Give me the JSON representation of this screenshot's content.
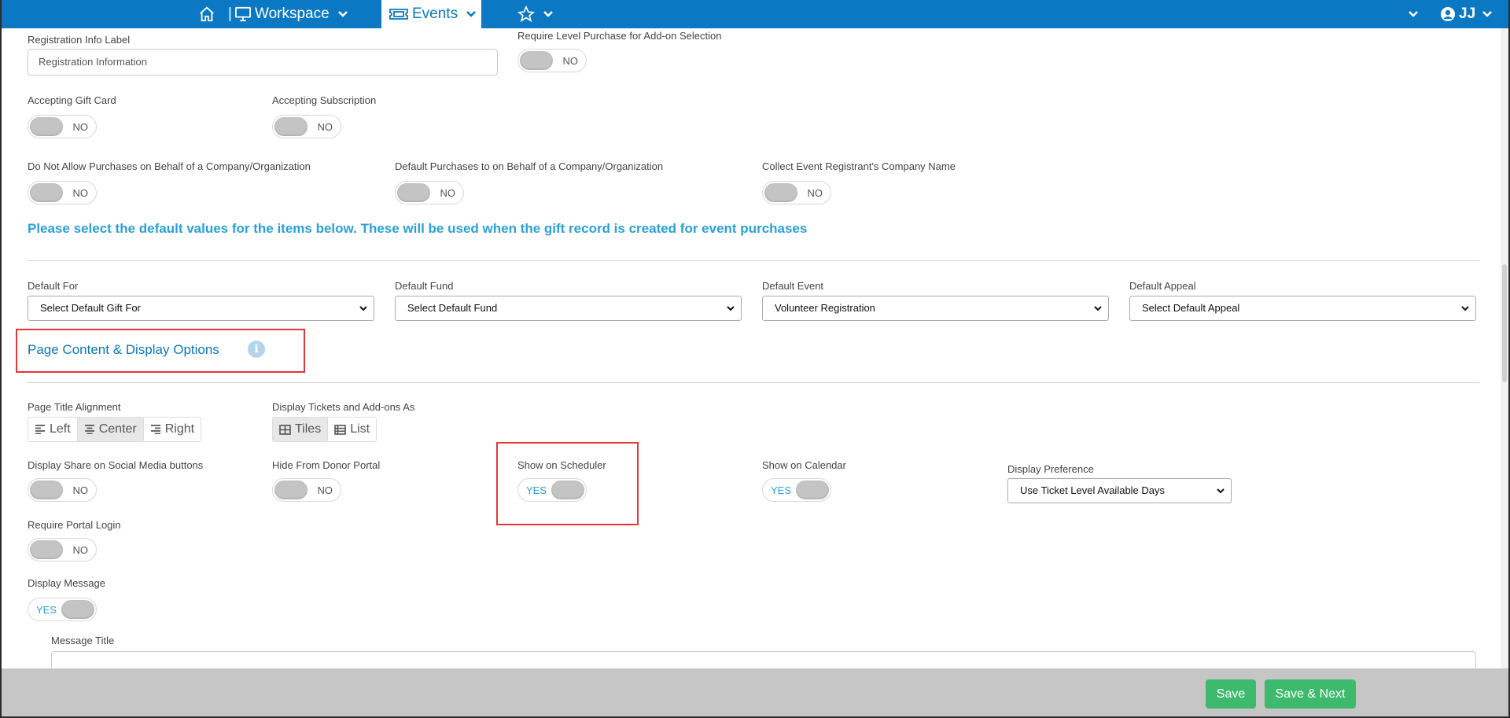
{
  "nav": {
    "workspace_label": "Workspace",
    "events_label": "Events",
    "separator": "|",
    "user_initials": "JJ"
  },
  "form": {
    "registration_info_label": "Registration Info Label",
    "registration_info_value": "Registration Information",
    "require_level_purchase_label": "Require Level Purchase for Add-on Selection",
    "require_level_purchase_value": "NO",
    "accepting_gift_card_label": "Accepting Gift Card",
    "accepting_gift_card_value": "NO",
    "accepting_subscription_label": "Accepting Subscription",
    "accepting_subscription_value": "NO",
    "no_behalf_label": "Do Not Allow Purchases on Behalf of a Company/Organization",
    "no_behalf_value": "NO",
    "default_behalf_label": "Default Purchases to on Behalf of a Company/Organization",
    "default_behalf_value": "NO",
    "collect_company_label": "Collect Event Registrant's Company Name",
    "collect_company_value": "NO",
    "defaults_heading": "Please select the default values for the items below. These will be used when the gift record is created for event purchases",
    "default_for_label": "Default For",
    "default_for_value": "Select Default Gift For",
    "default_fund_label": "Default Fund",
    "default_fund_value": "Select Default Fund",
    "default_event_label": "Default Event",
    "default_event_value": "Volunteer Registration",
    "default_appeal_label": "Default Appeal",
    "default_appeal_value": "Select Default Appeal",
    "page_content_title": "Page Content & Display Options",
    "info_glyph": "i",
    "page_title_alignment_label": "Page Title Alignment",
    "align_left": "Left",
    "align_center": "Center",
    "align_right": "Right",
    "display_tickets_label": "Display Tickets and Add-ons As",
    "tiles_label": "Tiles",
    "list_label": "List",
    "share_social_label": "Display Share on Social Media buttons",
    "share_social_value": "NO",
    "hide_portal_label": "Hide From Donor Portal",
    "hide_portal_value": "NO",
    "show_scheduler_label": "Show on Scheduler",
    "show_scheduler_value": "YES",
    "show_calendar_label": "Show on Calendar",
    "show_calendar_value": "YES",
    "display_preference_label": "Display Preference",
    "display_preference_value": "Use Ticket Level Available Days",
    "require_portal_login_label": "Require Portal Login",
    "require_portal_login_value": "NO",
    "display_message_label": "Display Message",
    "display_message_value": "YES",
    "message_title_label": "Message Title"
  },
  "footer": {
    "save_label": "Save",
    "save_next_label": "Save & Next"
  },
  "colors": {
    "nav_blue": "#0a78c2",
    "heading_blue": "#2aa0d8",
    "highlight_red": "#e3373a",
    "button_green": "#3dba6e"
  }
}
